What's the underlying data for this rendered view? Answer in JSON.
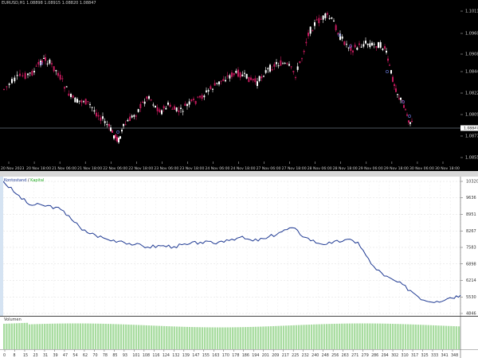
{
  "price_chart": {
    "symbol_info": "EURUSD,H1  1.08898 1.08915 1.08820 1.08847",
    "current_price": "1.08847",
    "background": "#000000",
    "bull_color": "#ffffff",
    "bear_color": "#c2185b",
    "marker_color": "#5c6bc0",
    "axis_text_color": "#cfcfcf",
    "price_labels": [
      "1.10115",
      "1.09600",
      "1.09080",
      "1.08445",
      "1.08220",
      "1.08090",
      "1.08847",
      "1.08775",
      "1.08555"
    ],
    "time_labels": [
      "20 Nov 2023",
      "20 Nov 18:00",
      "21 Nov 06:00",
      "21 Nov 18:00",
      "22 Nov 06:00",
      "22 Nov 18:00",
      "23 Nov 06:00",
      "23 Nov 18:00",
      "24 Nov 06:00",
      "24 Nov 18:00",
      "27 Nov 06:00",
      "27 Nov 18:00",
      "28 Nov 06:00",
      "28 Nov 18:00",
      "29 Nov 06:00",
      "29 Nov 18:00",
      "30 Nov 06:00",
      "30 Nov 18:00"
    ]
  },
  "balance_chart": {
    "legend_balance": "Kontostand",
    "legend_sep": " / ",
    "legend_equity": "Kapital",
    "balance_color": "#1f3a93",
    "equity_color": "#22aa22",
    "y_labels": [
      "10320",
      "9636",
      "8951",
      "8267",
      "7583",
      "6898",
      "6214",
      "5530",
      "4846"
    ]
  },
  "volume_chart": {
    "title": "Volumen",
    "bar_color": "#a8dca0",
    "x_labels": [
      "0",
      "8",
      "15",
      "23",
      "31",
      "39",
      "47",
      "54",
      "62",
      "70",
      "78",
      "85",
      "93",
      "101",
      "108",
      "116",
      "124",
      "132",
      "139",
      "147",
      "155",
      "163",
      "170",
      "178",
      "186",
      "194",
      "201",
      "209",
      "217",
      "225",
      "232",
      "240",
      "248",
      "256",
      "263",
      "271",
      "279",
      "286",
      "294",
      "302",
      "310",
      "317",
      "325",
      "333",
      "341",
      "348"
    ]
  },
  "chart_data": [
    {
      "type": "line",
      "title": "",
      "xlabel": "",
      "ylabel": "",
      "series": [
        {
          "name": "Kontostand",
          "x": [
            0,
            10,
            20,
            30,
            40,
            50,
            60,
            70,
            80,
            90,
            100,
            110,
            120,
            130,
            140,
            150,
            160,
            170,
            180,
            190,
            200,
            210,
            220,
            230,
            240,
            250,
            260,
            270,
            280,
            290,
            300,
            310,
            320,
            330,
            340,
            348
          ],
          "values": [
            10320,
            9800,
            9350,
            9330,
            9250,
            8900,
            8300,
            8100,
            7900,
            7850,
            7700,
            7600,
            7650,
            7620,
            7700,
            7800,
            7750,
            7900,
            8000,
            7850,
            7950,
            8200,
            8400,
            8000,
            7750,
            7750,
            7900,
            7800,
            6900,
            6400,
            6150,
            5800,
            5400,
            5350,
            5500,
            5600
          ]
        }
      ],
      "ylim": [
        4846,
        10320
      ]
    }
  ]
}
